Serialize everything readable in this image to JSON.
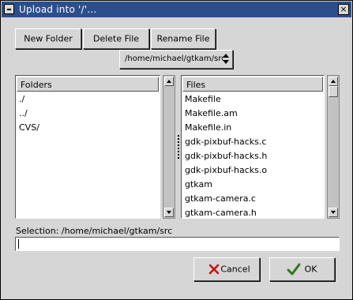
{
  "window": {
    "title": "Upload into '/'..."
  },
  "toolbar": {
    "new_folder": "New Folder",
    "delete_file": "Delete File",
    "rename_file": "Rename File"
  },
  "path_combo": {
    "value": "/home/michael/gtkam/src"
  },
  "folders": {
    "header": "Folders",
    "items": [
      "./",
      "../",
      "CVS/"
    ]
  },
  "files": {
    "header": "Files",
    "items": [
      "Makefile",
      "Makefile.am",
      "Makefile.in",
      "gdk-pixbuf-hacks.c",
      "gdk-pixbuf-hacks.h",
      "gdk-pixbuf-hacks.o",
      "gtkam",
      "gtkam-camera.c",
      "gtkam-camera.h"
    ]
  },
  "selection": {
    "label": "Selection: /home/michael/gtkam/src",
    "value": ""
  },
  "actions": {
    "cancel": "Cancel",
    "ok": "OK"
  },
  "icons": {
    "close": "close-icon",
    "cancel": "red-x-icon",
    "ok": "green-check-icon"
  },
  "colors": {
    "titlebar": "#2c4f8c",
    "cancel_icon": "#cc1111",
    "ok_icon": "#4c8a3a"
  }
}
